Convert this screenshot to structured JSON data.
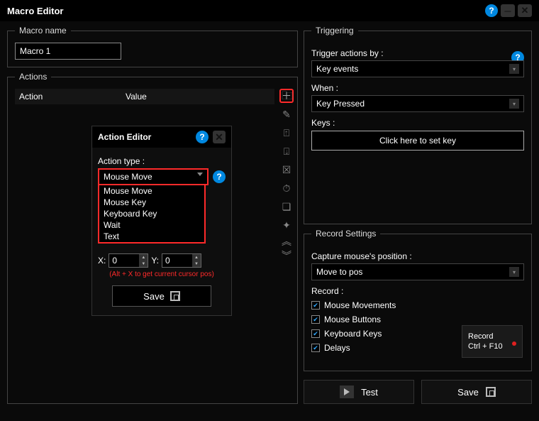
{
  "title": "Macro Editor",
  "macro_name": {
    "legend": "Macro name",
    "value": "Macro 1"
  },
  "actions": {
    "legend": "Actions",
    "col_action": "Action",
    "col_value": "Value"
  },
  "action_editor": {
    "title": "Action Editor",
    "type_label": "Action type :",
    "selected": "Mouse Move",
    "options": [
      "Mouse Move",
      "Mouse Key",
      "Keyboard Key",
      "Wait",
      "Text"
    ],
    "x_label": "X:",
    "y_label": "Y:",
    "x_value": "0",
    "y_value": "0",
    "hint": "(Alt + X to get current cursor pos)",
    "save": "Save"
  },
  "triggering": {
    "legend": "Triggering",
    "by_label": "Trigger actions by :",
    "by_value": "Key events",
    "when_label": "When :",
    "when_value": "Key Pressed",
    "keys_label": "Keys :",
    "keys_btn": "Click here to set key"
  },
  "record": {
    "legend": "Record Settings",
    "capture_label": "Capture mouse's position :",
    "capture_value": "Move to pos",
    "record_label": "Record :",
    "opts": {
      "mouse_mv": "Mouse Movements",
      "mouse_btn": "Mouse Buttons",
      "keys": "Keyboard Keys",
      "delays": "Delays"
    },
    "record_btn_l1": "Record",
    "record_btn_l2": "Ctrl + F10"
  },
  "buttons": {
    "test": "Test",
    "save": "Save"
  }
}
